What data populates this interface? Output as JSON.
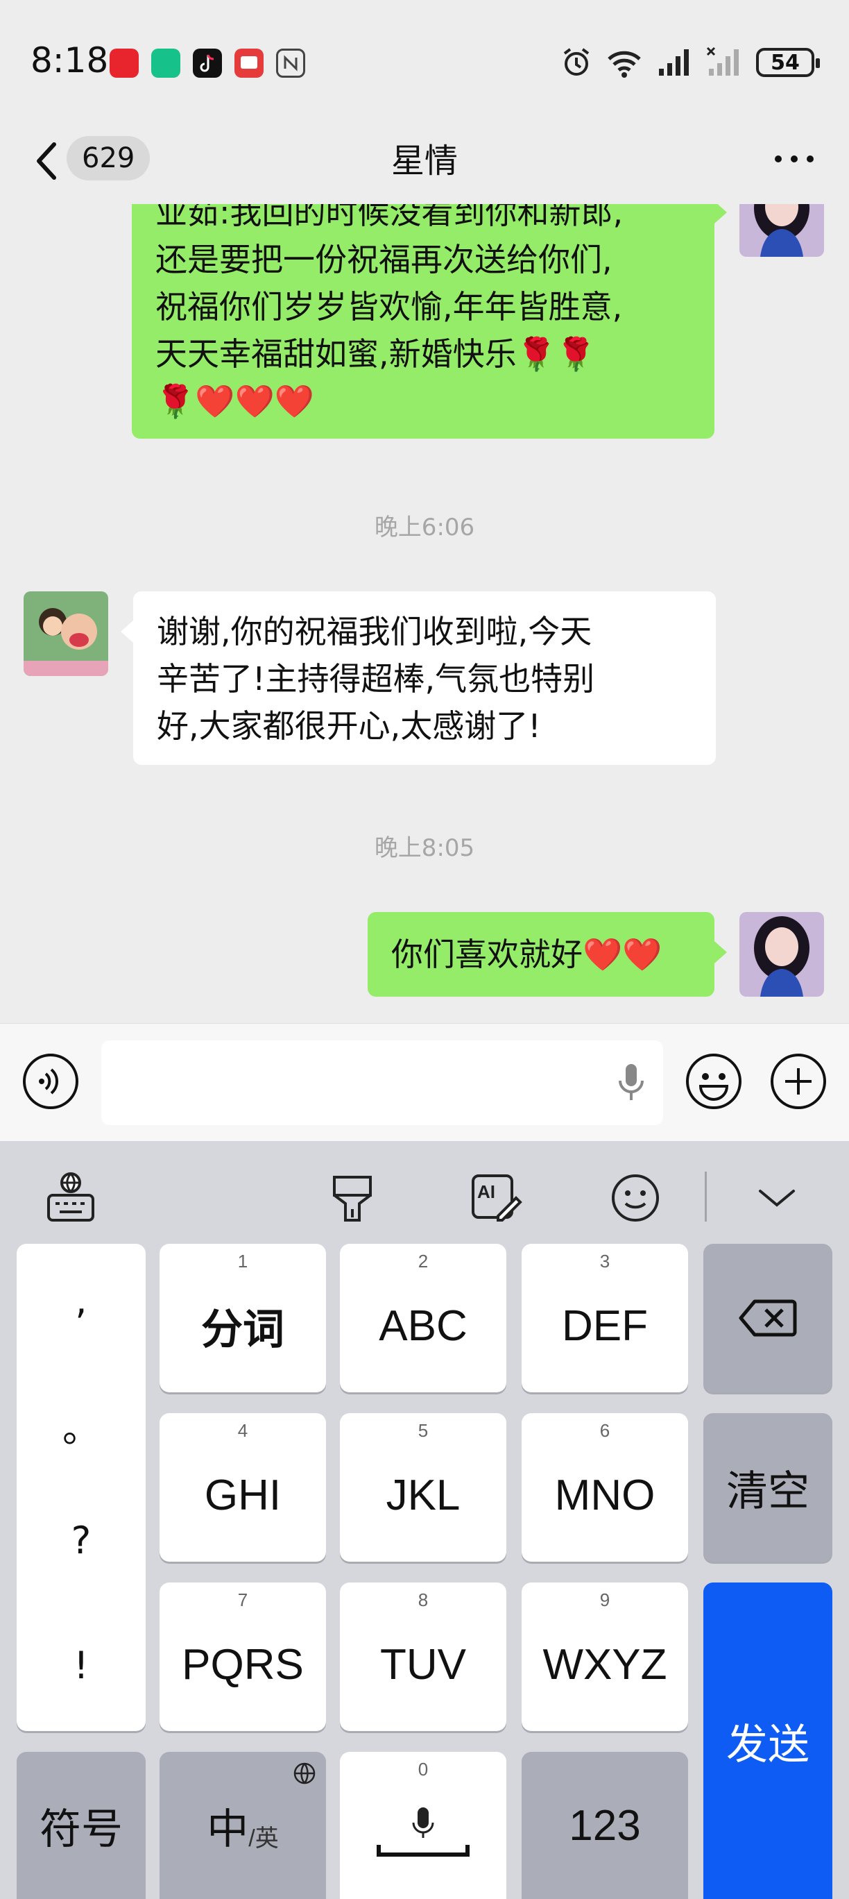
{
  "status_bar": {
    "time": "8:18",
    "battery": "54",
    "app_icons": [
      "huawei-appgallery-icon",
      "green-app-icon",
      "tiktok-icon",
      "red-app-icon",
      "nfc-icon"
    ],
    "right_icons": [
      "alarm-icon",
      "wifi-icon",
      "signal-icon",
      "no-signal-icon"
    ]
  },
  "nav": {
    "unread_count": "629",
    "title": "星情"
  },
  "messages": [
    {
      "side": "right",
      "lines": [
        "业茹:我回的时候没看到你和新郎,",
        "还是要把一份祝福再次送给你们,",
        "祝福你们岁岁皆欢愉,年年皆胜意,",
        "天天幸福甜如蜜,新婚快乐🌹🌹",
        "🌹❤️❤️❤️"
      ]
    },
    {
      "timestamp": "晚上6:06"
    },
    {
      "side": "left",
      "lines": [
        "谢谢,你的祝福我们收到啦,今天",
        "辛苦了!主持得超棒,气氛也特别",
        "好,大家都很开心,太感谢了!"
      ]
    },
    {
      "timestamp": "晚上8:05"
    },
    {
      "side": "right",
      "lines": [
        "你们喜欢就好❤️❤️"
      ]
    }
  ],
  "keyboard": {
    "punctuation": [
      ",",
      "。",
      "?",
      "!"
    ],
    "keys": [
      {
        "num": "1",
        "label": "分词"
      },
      {
        "num": "2",
        "label": "ABC"
      },
      {
        "num": "3",
        "label": "DEF"
      },
      {
        "num": "4",
        "label": "GHI"
      },
      {
        "num": "5",
        "label": "JKL"
      },
      {
        "num": "6",
        "label": "MNO"
      },
      {
        "num": "7",
        "label": "PQRS"
      },
      {
        "num": "8",
        "label": "TUV"
      },
      {
        "num": "9",
        "label": "WXYZ"
      }
    ],
    "clear": "清空",
    "send": "发送",
    "symbols": "符号",
    "lang_main": "中",
    "lang_sub": "/英",
    "space_num": "0",
    "numbers": "123"
  },
  "colors": {
    "accent_green": "#95ec69",
    "send_blue": "#0f5cf5",
    "background": "#ededed"
  }
}
